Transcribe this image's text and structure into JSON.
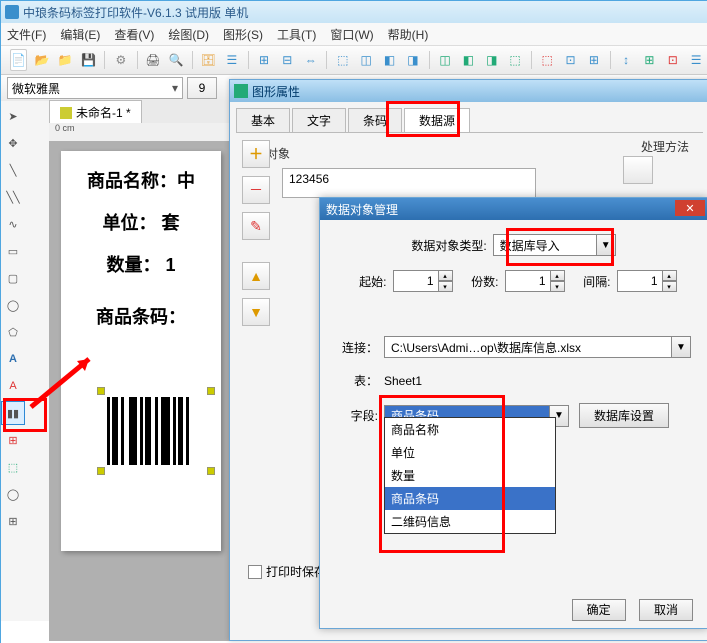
{
  "app": {
    "title": "中琅条码标签打印软件-V6.1.3 试用版 单机"
  },
  "menubar": [
    "文件(F)",
    "编辑(E)",
    "查看(V)",
    "绘图(D)",
    "图形(S)",
    "工具(T)",
    "窗口(W)",
    "帮助(H)"
  ],
  "font": {
    "name": "微软雅黑",
    "size": "9"
  },
  "doc_tab": "未命名-1 *",
  "ruler": "0 cm",
  "label": {
    "line1": "商品名称：中",
    "line2": "单位：  套",
    "line3": "数量：  1",
    "line4": "商品条码："
  },
  "dlg1": {
    "title": "图形属性",
    "tabs": [
      "基本",
      "文字",
      "条码",
      "数据源"
    ],
    "active_tab": 3,
    "group_data_obj": "数据对象",
    "group_process": "处理方法",
    "list_value": "123456",
    "print_save": "打印时保存"
  },
  "dlg2": {
    "title": "数据对象管理",
    "type_label": "数据对象类型:",
    "type_value": "数据库导入",
    "start_label": "起始:",
    "start_value": "1",
    "count_label": "份数:",
    "count_value": "1",
    "gap_label": "间隔:",
    "gap_value": "1",
    "conn_label": "连接：",
    "conn_value": "C:\\Users\\Admi…op\\数据库信息.xlsx",
    "table_label": "表：",
    "table_value": "Sheet1",
    "field_label": "字段:",
    "field_value": "商品条码",
    "db_settings_btn": "数据库设置",
    "options": [
      "商品名称",
      "单位",
      "数量",
      "商品条码",
      "二维码信息"
    ],
    "ok": "确定",
    "cancel": "取消"
  }
}
